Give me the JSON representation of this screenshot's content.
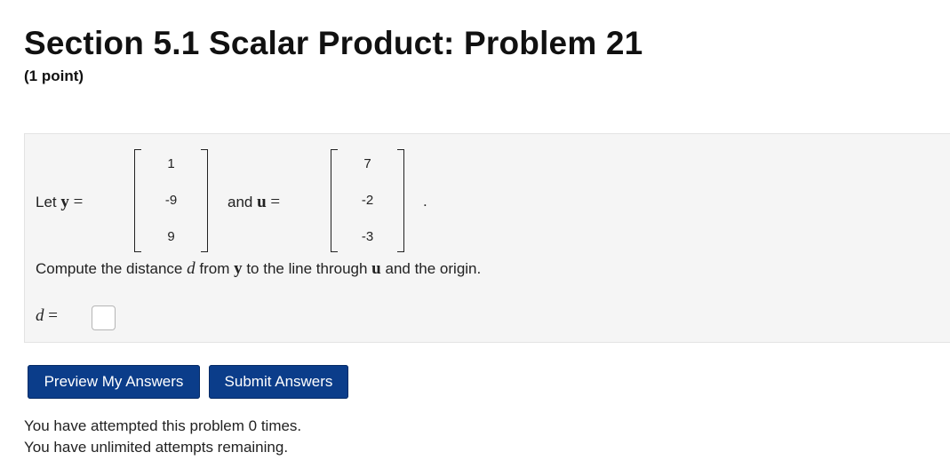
{
  "page": {
    "title": "Section 5.1 Scalar Product: Problem 21",
    "points": "(1 point)"
  },
  "problem": {
    "let_text": "Let",
    "y_symbol": "y",
    "equals": "=",
    "and_text": "and",
    "u_symbol": "u",
    "period": ".",
    "y_vector": [
      "1",
      "-9",
      "9"
    ],
    "u_vector": [
      "7",
      "-2",
      "-3"
    ],
    "compute_prefix": "Compute the distance",
    "d_symbol": "d",
    "from_text": "from",
    "to_line_text": "to the line through",
    "origin_text": "and the origin."
  },
  "answer": {
    "label": "d",
    "equals": "=",
    "value": ""
  },
  "buttons": {
    "preview": "Preview My Answers",
    "submit": "Submit Answers"
  },
  "status": {
    "attempts": "You have attempted this problem 0 times.",
    "remaining": "You have unlimited attempts remaining."
  }
}
